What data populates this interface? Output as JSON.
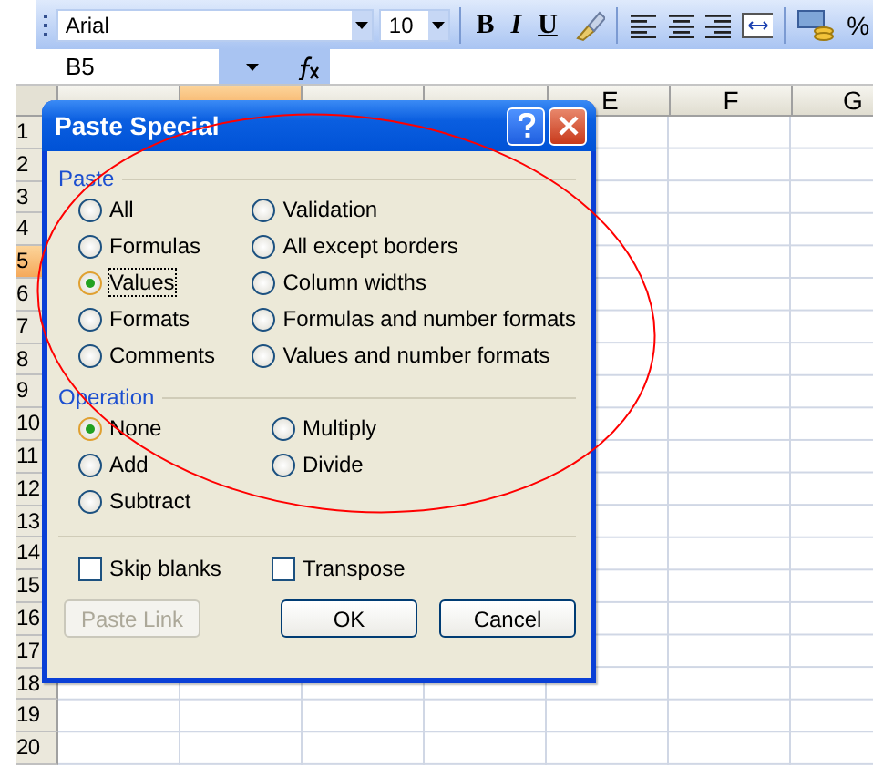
{
  "toolbar": {
    "font": "Arial",
    "size": "10",
    "format_buttons": [
      "B",
      "I",
      "U"
    ],
    "percent": "%"
  },
  "formula_bar": {
    "name_box": "B5"
  },
  "columns": [
    {
      "selected": false
    },
    {
      "selected": true
    },
    {
      "selected": false
    },
    {
      "selected": false
    },
    {
      "label": "E",
      "selected": false
    },
    {
      "label": "F",
      "selected": false
    },
    {
      "label": "G",
      "selected": false
    }
  ],
  "rows": [
    {
      "label": "1",
      "selected": false
    },
    {
      "label": "2",
      "selected": false
    },
    {
      "label": "3",
      "selected": false
    },
    {
      "label": "4",
      "selected": false
    },
    {
      "label": "5",
      "selected": true
    },
    {
      "label": "6",
      "selected": false
    },
    {
      "label": "7",
      "selected": false
    },
    {
      "label": "8",
      "selected": false
    },
    {
      "label": "9",
      "selected": false
    },
    {
      "label": "10",
      "selected": false
    },
    {
      "label": "11",
      "selected": false
    },
    {
      "label": "12",
      "selected": false
    },
    {
      "label": "13",
      "selected": false
    },
    {
      "label": "14",
      "selected": false
    },
    {
      "label": "15",
      "selected": false
    },
    {
      "label": "16",
      "selected": false
    },
    {
      "label": "17",
      "selected": false
    },
    {
      "label": "18",
      "selected": false
    },
    {
      "label": "19",
      "selected": false
    },
    {
      "label": "20",
      "selected": false
    }
  ],
  "dialog": {
    "title": "Paste Special",
    "paste": {
      "heading": "Paste",
      "options": [
        {
          "label": "All",
          "selected": false
        },
        {
          "label": "Formulas",
          "selected": false
        },
        {
          "label": "Values",
          "selected": true
        },
        {
          "label": "Formats",
          "selected": false
        },
        {
          "label": "Comments",
          "selected": false
        },
        {
          "label": "Validation",
          "selected": false
        },
        {
          "label": "All except borders",
          "selected": false
        },
        {
          "label": "Column widths",
          "selected": false
        },
        {
          "label": "Formulas and number formats",
          "selected": false
        },
        {
          "label": "Values and number formats",
          "selected": false
        }
      ]
    },
    "operation": {
      "heading": "Operation",
      "options": [
        {
          "label": "None",
          "selected": true
        },
        {
          "label": "Add",
          "selected": false
        },
        {
          "label": "Subtract",
          "selected": false
        },
        {
          "label": "Multiply",
          "selected": false
        },
        {
          "label": "Divide",
          "selected": false
        }
      ]
    },
    "checkboxes": [
      {
        "label": "Skip blanks",
        "checked": false
      },
      {
        "label": "Transpose",
        "checked": false
      }
    ],
    "buttons": [
      {
        "label": "Paste Link",
        "disabled": true
      },
      {
        "label": "OK",
        "disabled": false
      },
      {
        "label": "Cancel",
        "disabled": false
      }
    ]
  },
  "annotation": {
    "kind": "ellipse",
    "color": "#ff0000"
  }
}
